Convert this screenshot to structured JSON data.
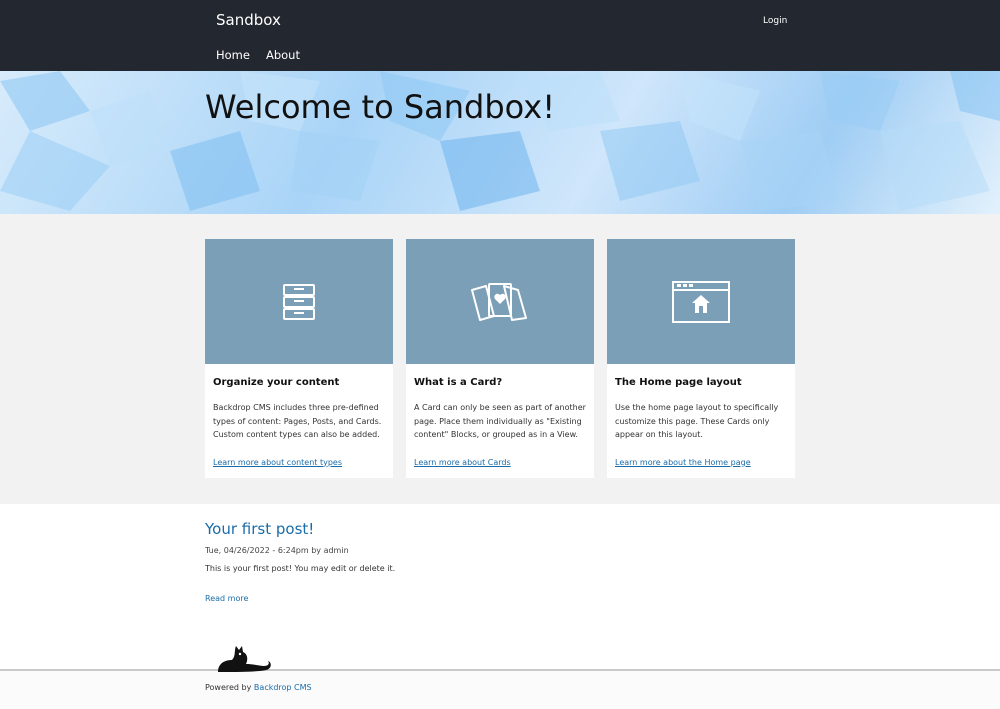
{
  "header": {
    "site_name": "Sandbox",
    "login_label": "Login",
    "nav": [
      {
        "label": "Home"
      },
      {
        "label": "About"
      }
    ]
  },
  "hero": {
    "title": "Welcome to Sandbox!"
  },
  "cards": [
    {
      "icon": "file-cabinet-icon",
      "title": "Organize your content",
      "text": "Backdrop CMS includes three pre-defined types of content: Pages, Posts, and Cards. Custom content types can also be added.",
      "link": "Learn more about content types"
    },
    {
      "icon": "cards-icon",
      "title": "What is a Card?",
      "text": "A Card can only be seen as part of another page. Place them individually as \"Existing content\" Blocks, or grouped as in a View.",
      "link": "Learn more about Cards"
    },
    {
      "icon": "home-layout-icon",
      "title": "The Home page layout",
      "text": "Use the home page layout to specifically customize this page. These Cards only appear on this layout.",
      "link": "Learn more about the Home page"
    }
  ],
  "post": {
    "title": "Your first post!",
    "meta": "Tue, 04/26/2022 - 6:24pm by admin",
    "body": "This is your first post! You may edit or delete it.",
    "read_more": "Read more"
  },
  "footer": {
    "powered_prefix": "Powered by ",
    "powered_link": "Backdrop CMS"
  },
  "colors": {
    "header_bg": "#23272f",
    "card_image_bg": "#7a9fb7",
    "link": "#1a6ca8",
    "band_bg": "#f2f2f2"
  }
}
